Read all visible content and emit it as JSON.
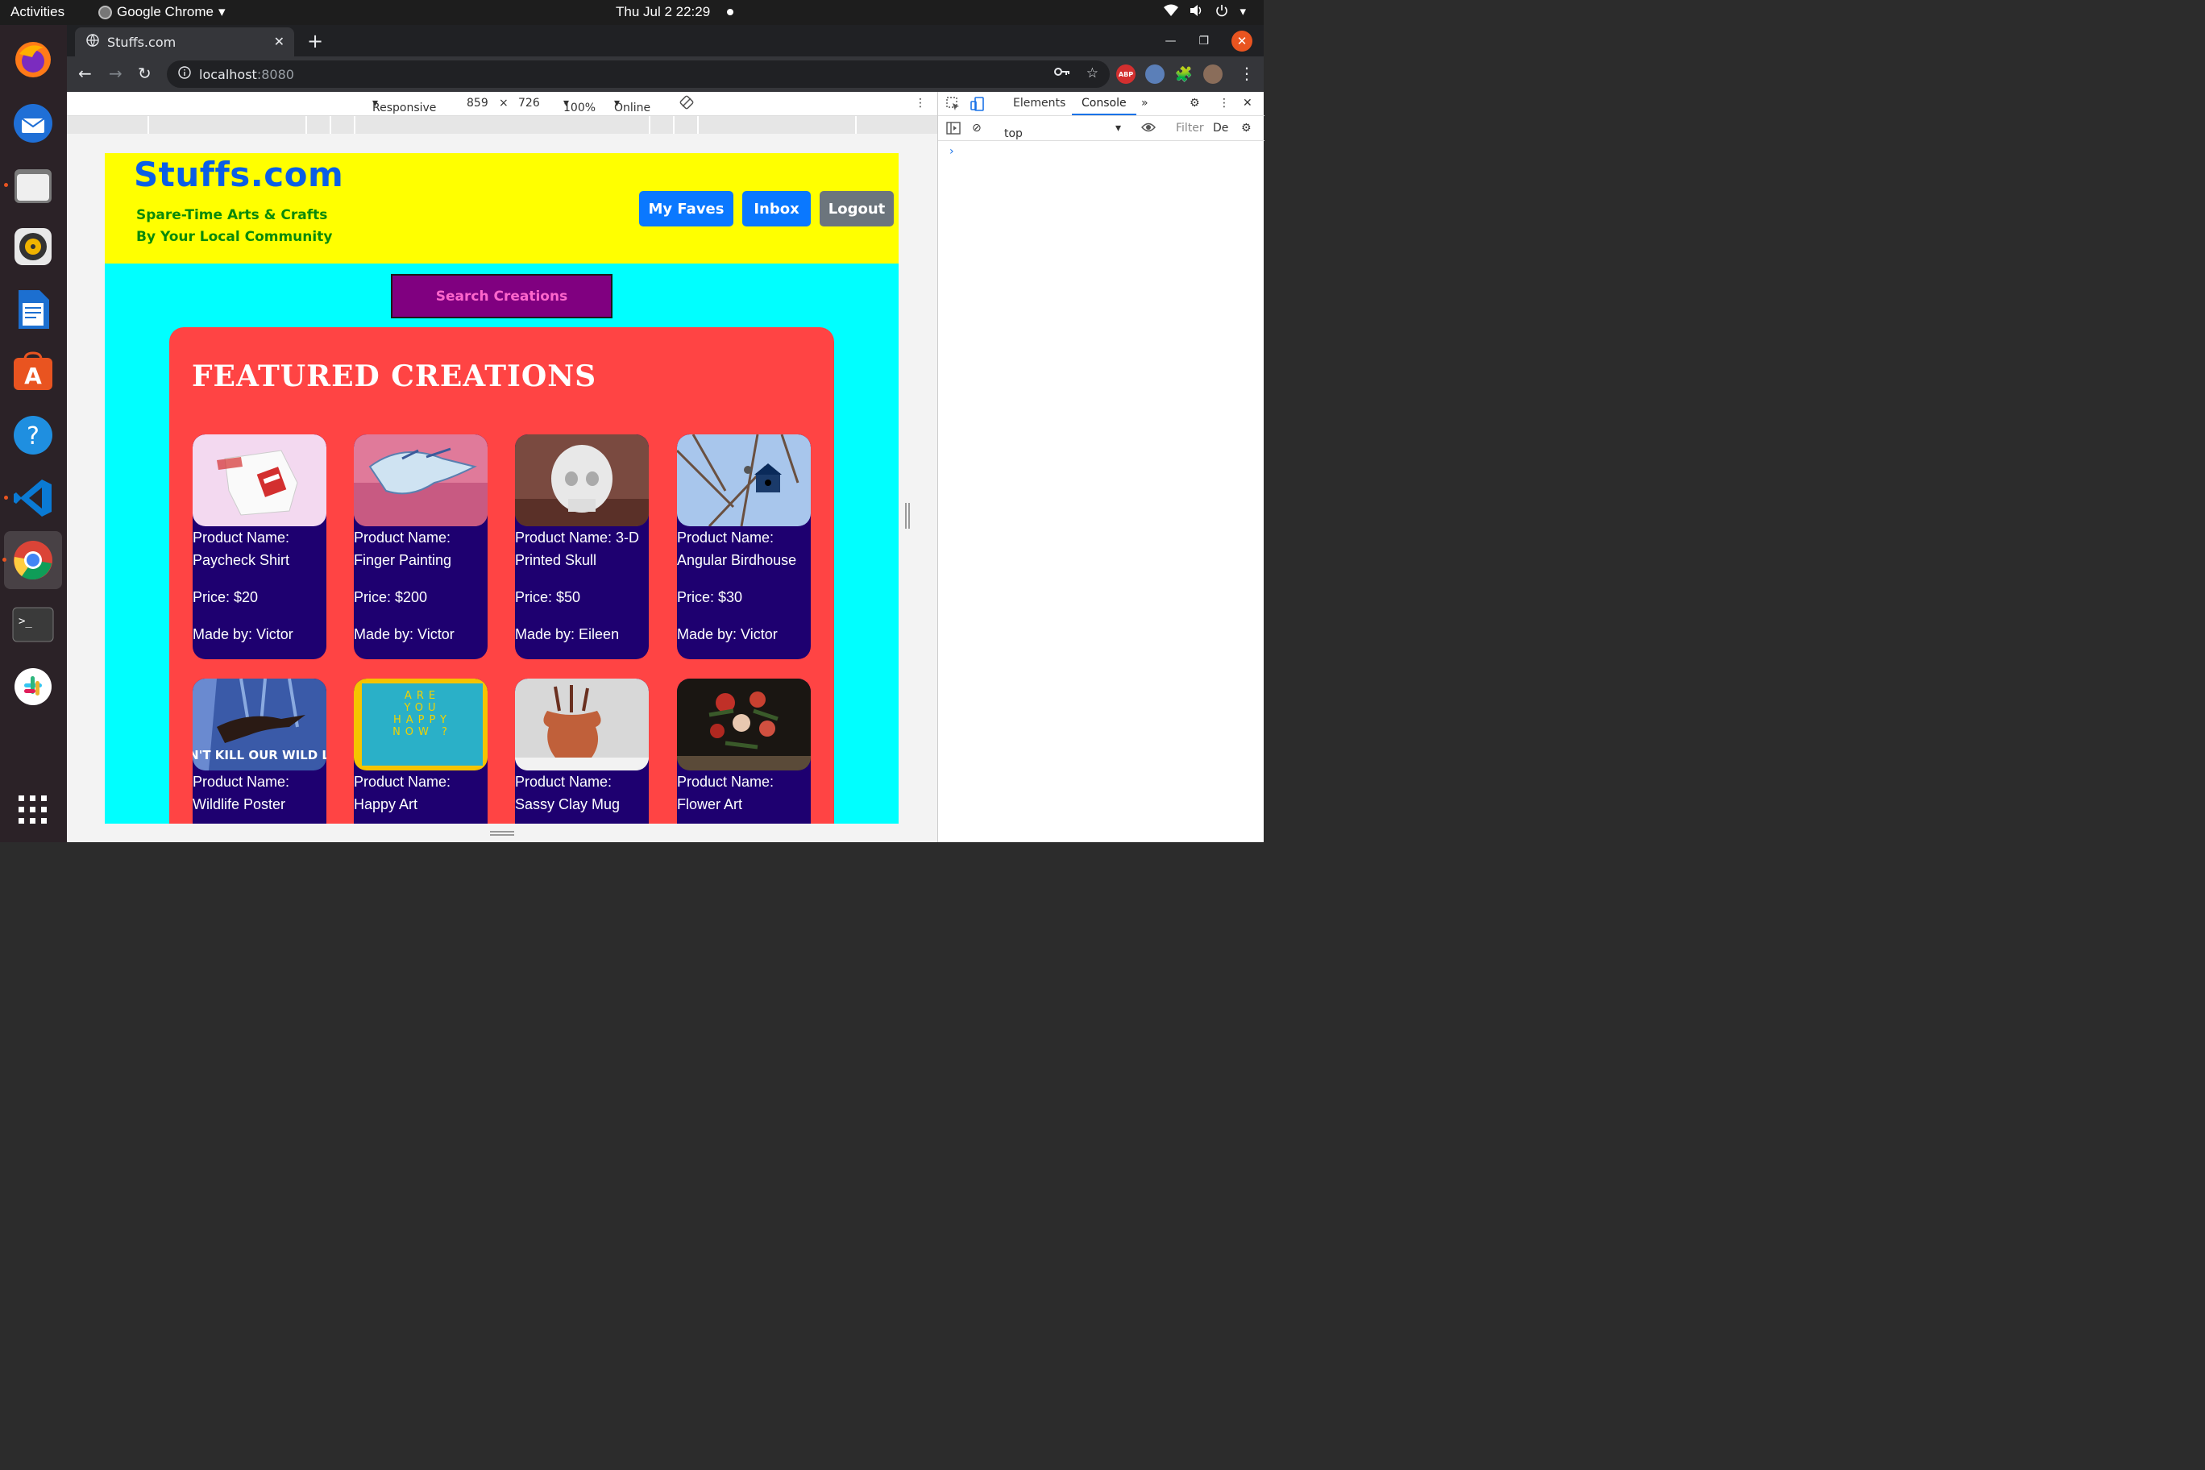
{
  "system": {
    "activities": "Activities",
    "app_name": "Google Chrome",
    "clock": "Thu Jul 2  22:29"
  },
  "browser": {
    "tab_title": "Stuffs.com",
    "url_host": "localhost",
    "url_port": ":8080",
    "ext_abp": "ABP"
  },
  "device_toolbar": {
    "mode": "Responsive",
    "width": "859",
    "times": "×",
    "height": "726",
    "zoom": "100%",
    "network": "Online"
  },
  "devtools": {
    "tab_elements": "Elements",
    "tab_console": "Console",
    "more": "»",
    "context": "top",
    "filter_placeholder": "Filter",
    "levels": "De",
    "prompt": "›"
  },
  "site": {
    "logo": "Stuffs.com",
    "tagline_line1": "Spare-Time Arts & Crafts",
    "tagline_line2": "By Your Local Community",
    "nav": {
      "faves": "My Faves",
      "inbox": "Inbox",
      "logout": "Logout"
    },
    "search_button": "Search Creations",
    "featured_title": "FEATURED CREATIONS",
    "products": [
      {
        "name": "Product Name: Paycheck Shirt",
        "price": "Price: $20",
        "maker": "Made by: Victor"
      },
      {
        "name": "Product Name: Finger Painting",
        "price": "Price: $200",
        "maker": "Made by: Victor"
      },
      {
        "name": "Product Name: 3-D Printed Skull",
        "price": "Price: $50",
        "maker": "Made by: Eileen"
      },
      {
        "name": "Product Name: Angular Birdhouse",
        "price": "Price: $30",
        "maker": "Made by: Victor"
      },
      {
        "name": "Product Name: Wildlife Poster",
        "price": "",
        "maker": ""
      },
      {
        "name": "Product Name: Happy Art",
        "price": "",
        "maker": ""
      },
      {
        "name": "Product Name: Sassy Clay Mug",
        "price": "",
        "maker": ""
      },
      {
        "name": "Product Name: Flower Art",
        "price": "",
        "maker": ""
      }
    ],
    "poster_text": "DON'T KILL OUR WILD LIFE",
    "happy_text": "ARE YOU HAPPY NOW ?"
  },
  "colors": {
    "header_bg": "#ffff00",
    "page_bg": "#00ffff",
    "featured_bg": "#ff4444",
    "card_bg": "#1e0070",
    "primary_btn": "#0a78ff",
    "secondary_btn": "#6c757d",
    "search_btn": "#800080"
  }
}
